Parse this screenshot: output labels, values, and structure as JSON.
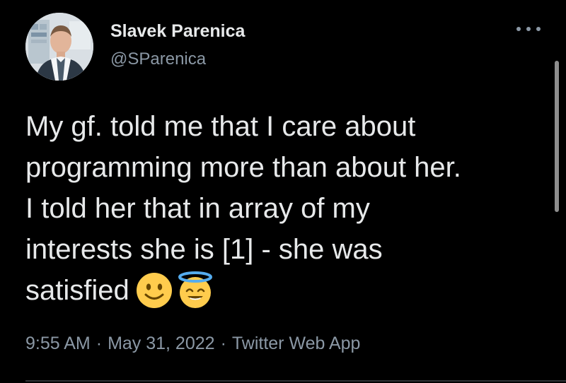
{
  "tweet": {
    "author": {
      "display_name": "Slavek Parenica",
      "handle": "@SParenica",
      "avatar_icon": "profile-photo"
    },
    "more_icon": "more-horizontal-icon",
    "text_lines": [
      "My gf. told me that I care about",
      "programming more than about her.",
      "I told her that in array of my",
      "interests she is [1] - she was",
      "satisfied"
    ],
    "emojis": [
      "slightly-smiling-face-icon",
      "smiling-face-with-halo-icon"
    ],
    "time": "9:55 AM",
    "date": "May 31, 2022",
    "source": "Twitter Web App",
    "separator": "·"
  },
  "colors": {
    "background": "#000000",
    "primary_text": "#e7e9ea",
    "secondary_text": "#8b98a5",
    "divider": "#2f3336"
  }
}
